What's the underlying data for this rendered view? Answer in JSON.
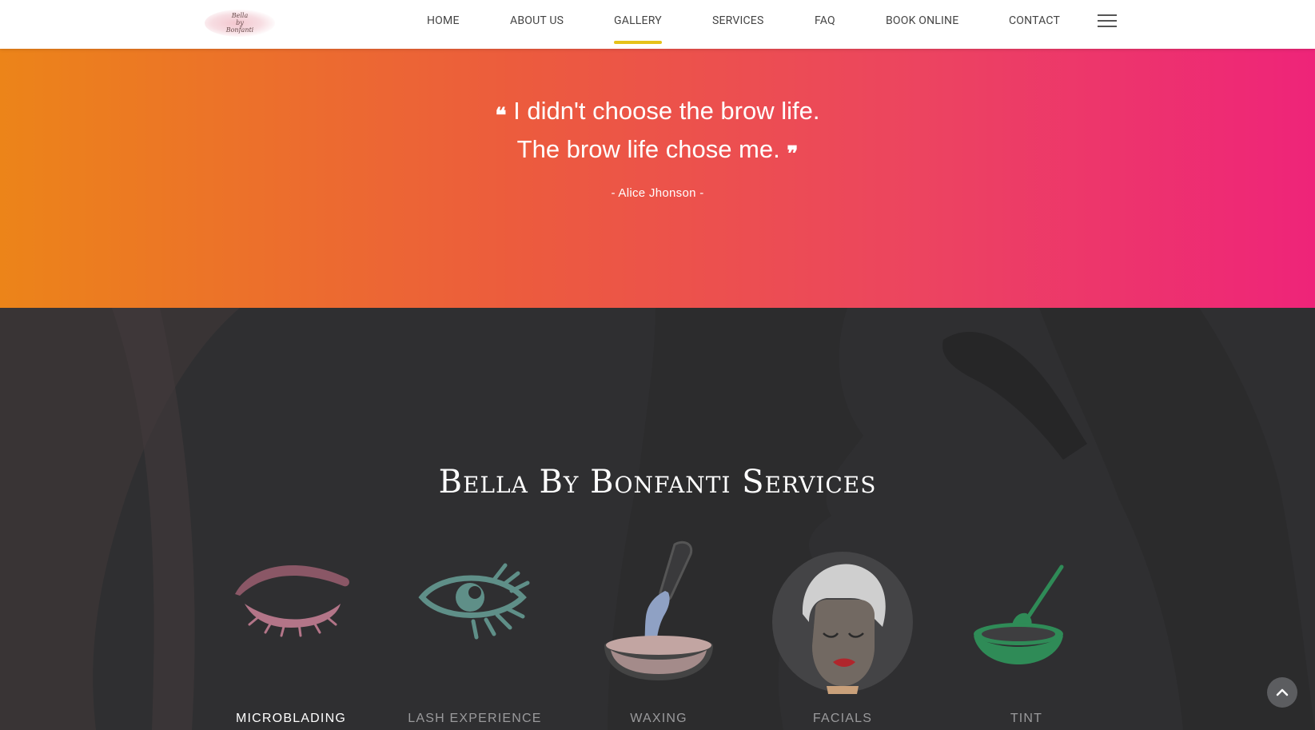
{
  "nav": {
    "logo_text_line1": "Bella",
    "logo_text_line2": "by",
    "logo_text_line3": "Bonfanti",
    "items": [
      {
        "label": "HOME"
      },
      {
        "label": "ABOUT US"
      },
      {
        "label": "GALLERY"
      },
      {
        "label": "SERVICES"
      },
      {
        "label": "FAQ"
      },
      {
        "label": "BOOK ONLINE"
      },
      {
        "label": "CONTACT"
      }
    ],
    "active_item": "GALLERY",
    "accent_color": "#e6c21a",
    "menu_icon": "hamburger-icon"
  },
  "quote": {
    "line1": "I didn't choose the brow life.",
    "line2": "The brow life chose me.",
    "author": "- Alice Jhonson -",
    "open_mark": "❝",
    "close_mark": "❞",
    "gradient_start": "#ec8419",
    "gradient_end": "#ee2479"
  },
  "services": {
    "title": "Bella By Bonfanti Services",
    "items": [
      {
        "label": "MICROBLADING",
        "icon": "eyebrow-icon",
        "active": true
      },
      {
        "label": "LASH EXPERIENCE",
        "icon": "eye-icon",
        "active": false
      },
      {
        "label": "WAXING",
        "icon": "wax-pot-icon",
        "active": false
      },
      {
        "label": "FACIALS",
        "icon": "facial-mask-icon",
        "active": false
      },
      {
        "label": "TINT",
        "icon": "tint-bowl-icon",
        "active": false
      }
    ]
  },
  "scroll_top": {
    "icon": "chevron-up-icon"
  }
}
